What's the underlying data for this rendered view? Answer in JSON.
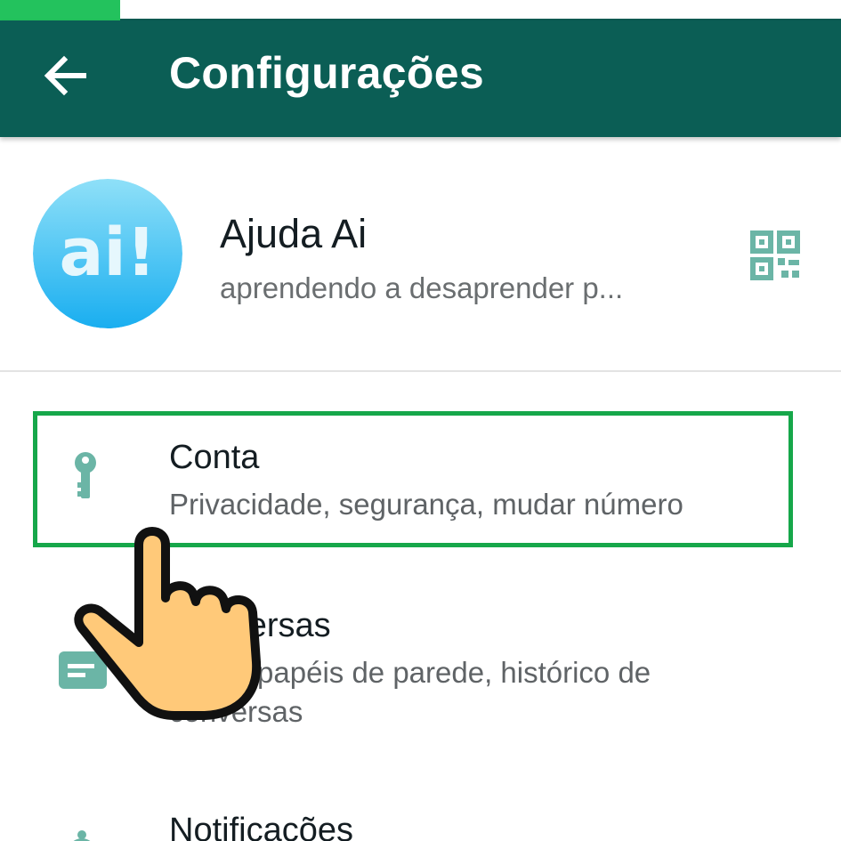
{
  "status": {
    "progress_percent": 14.3,
    "colors": {
      "fill": "#23c25d",
      "track": "#ffffff"
    }
  },
  "app_bar": {
    "title": "Configurações",
    "back_icon": "arrow-back-icon",
    "background": "#0b5e55"
  },
  "profile": {
    "name": "Ajuda Ai",
    "about": "aprendendo a desaprender p...",
    "avatar_text": "ai!",
    "qr_icon": "qr-code-icon"
  },
  "settings": {
    "items": [
      {
        "title": "Conta",
        "subtitle": "Privacidade, segurança, mudar número",
        "icon": "key-icon"
      },
      {
        "title": "Conversas",
        "subtitle": "Tema, papéis de parede, histórico de conversas",
        "icon": "chat-icon"
      },
      {
        "title": "Notificações",
        "subtitle": "",
        "icon": "bell-icon"
      }
    ]
  },
  "overlay": {
    "highlight_color": "#16a74a",
    "pointer_icon": "pointing-hand-icon"
  },
  "colors": {
    "accent": "#0b5e55",
    "icon_tint": "#6bb5a6",
    "primary_text": "#141d22",
    "secondary_text": "#5f6366"
  }
}
